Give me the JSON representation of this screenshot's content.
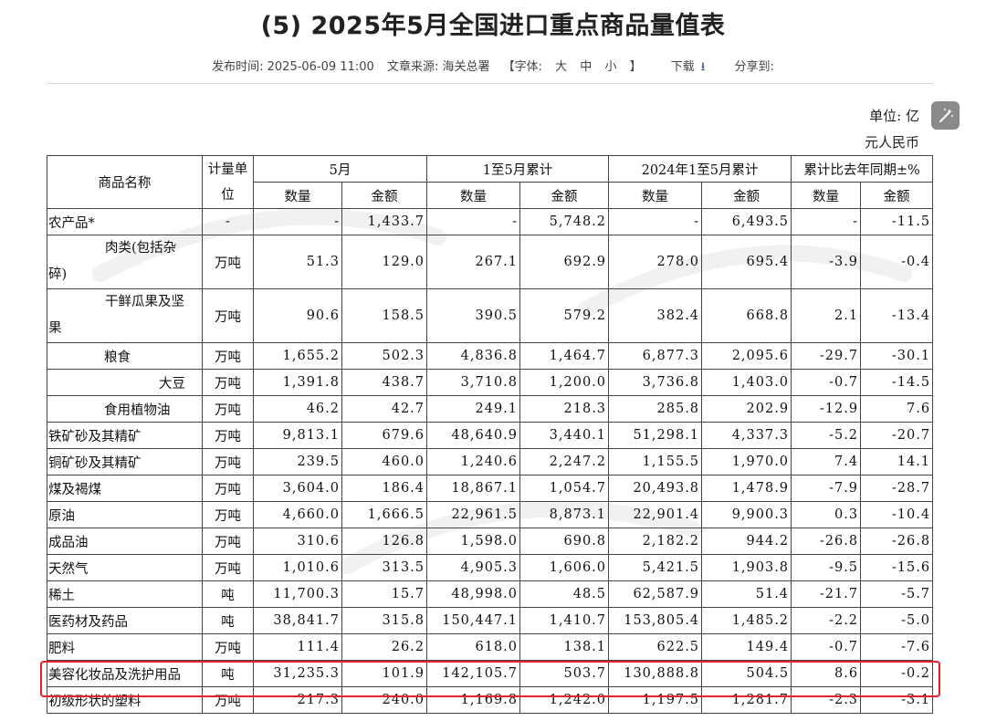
{
  "page": {
    "title": "(5) 2025年5月全国进口重点商品量值表",
    "meta": {
      "publish_label": "发布时间: 2025-06-09 11:00",
      "source_label": "文章来源: 海关总署",
      "font_label_open": "【字体:",
      "font_large": "大",
      "font_medium": "中",
      "font_small": "小",
      "font_label_close": "】",
      "download": "下载",
      "share": "分享到:"
    },
    "unit_line1": "单位: 亿",
    "unit_line2": "元人民币"
  },
  "table": {
    "headers": {
      "name": "商品名称",
      "unit": "计量单位",
      "may": "5月",
      "ytd": "1至5月累计",
      "prev_ytd": "2024年1至5月累计",
      "yoy": "累计比去年同期±%",
      "qty": "数量",
      "amt": "金额"
    },
    "rows": [
      {
        "name": "农产品*",
        "indent": 0,
        "unit": "-",
        "may_qty": "-",
        "may_amt": "1,433.7",
        "ytd_qty": "-",
        "ytd_amt": "5,748.2",
        "prev_qty": "-",
        "prev_amt": "6,493.5",
        "yoy_qty": "-",
        "yoy_amt": "-11.5"
      },
      {
        "name_a": "肉类(包括杂",
        "name_b": "碎)",
        "wrap": true,
        "unit": "万吨",
        "may_qty": "51.3",
        "may_amt": "129.0",
        "ytd_qty": "267.1",
        "ytd_amt": "692.9",
        "prev_qty": "278.0",
        "prev_amt": "695.4",
        "yoy_qty": "-3.9",
        "yoy_amt": "-0.4"
      },
      {
        "name_a": "干鲜瓜果及坚",
        "name_b": "果",
        "wrap": true,
        "unit": "万吨",
        "may_qty": "90.6",
        "may_amt": "158.5",
        "ytd_qty": "390.5",
        "ytd_amt": "579.2",
        "prev_qty": "382.4",
        "prev_amt": "668.8",
        "yoy_qty": "2.1",
        "yoy_amt": "-13.4"
      },
      {
        "name": "粮食",
        "indent": 1,
        "unit": "万吨",
        "may_qty": "1,655.2",
        "may_amt": "502.3",
        "ytd_qty": "4,836.8",
        "ytd_amt": "1,464.7",
        "prev_qty": "6,877.3",
        "prev_amt": "2,095.6",
        "yoy_qty": "-29.7",
        "yoy_amt": "-30.1"
      },
      {
        "name": "大豆",
        "indent": 2,
        "unit": "万吨",
        "may_qty": "1,391.8",
        "may_amt": "438.7",
        "ytd_qty": "3,710.8",
        "ytd_amt": "1,200.0",
        "prev_qty": "3,736.8",
        "prev_amt": "1,403.0",
        "yoy_qty": "-0.7",
        "yoy_amt": "-14.5"
      },
      {
        "name": "食用植物油",
        "indent": 1,
        "unit": "万吨",
        "may_qty": "46.2",
        "may_amt": "42.7",
        "ytd_qty": "249.1",
        "ytd_amt": "218.3",
        "prev_qty": "285.8",
        "prev_amt": "202.9",
        "yoy_qty": "-12.9",
        "yoy_amt": "7.6"
      },
      {
        "name": "铁矿砂及其精矿",
        "indent": 0,
        "unit": "万吨",
        "may_qty": "9,813.1",
        "may_amt": "679.6",
        "ytd_qty": "48,640.9",
        "ytd_amt": "3,440.1",
        "prev_qty": "51,298.1",
        "prev_amt": "4,337.3",
        "yoy_qty": "-5.2",
        "yoy_amt": "-20.7"
      },
      {
        "name": "铜矿砂及其精矿",
        "indent": 0,
        "unit": "万吨",
        "may_qty": "239.5",
        "may_amt": "460.0",
        "ytd_qty": "1,240.6",
        "ytd_amt": "2,247.2",
        "prev_qty": "1,155.5",
        "prev_amt": "1,970.0",
        "yoy_qty": "7.4",
        "yoy_amt": "14.1"
      },
      {
        "name": "煤及褐煤",
        "indent": 0,
        "unit": "万吨",
        "may_qty": "3,604.0",
        "may_amt": "186.4",
        "ytd_qty": "18,867.1",
        "ytd_amt": "1,054.7",
        "prev_qty": "20,493.8",
        "prev_amt": "1,478.9",
        "yoy_qty": "-7.9",
        "yoy_amt": "-28.7"
      },
      {
        "name": "原油",
        "indent": 0,
        "unit": "万吨",
        "may_qty": "4,660.0",
        "may_amt": "1,666.5",
        "ytd_qty": "22,961.5",
        "ytd_amt": "8,873.1",
        "prev_qty": "22,901.4",
        "prev_amt": "9,900.3",
        "yoy_qty": "0.3",
        "yoy_amt": "-10.4"
      },
      {
        "name": "成品油",
        "indent": 0,
        "unit": "万吨",
        "may_qty": "310.6",
        "may_amt": "126.8",
        "ytd_qty": "1,598.0",
        "ytd_amt": "690.8",
        "prev_qty": "2,182.2",
        "prev_amt": "944.2",
        "yoy_qty": "-26.8",
        "yoy_amt": "-26.8"
      },
      {
        "name": "天然气",
        "indent": 0,
        "unit": "万吨",
        "may_qty": "1,010.6",
        "may_amt": "313.5",
        "ytd_qty": "4,905.3",
        "ytd_amt": "1,606.0",
        "prev_qty": "5,421.5",
        "prev_amt": "1,903.8",
        "yoy_qty": "-9.5",
        "yoy_amt": "-15.6"
      },
      {
        "name": "稀土",
        "indent": 0,
        "unit": "吨",
        "may_qty": "11,700.3",
        "may_amt": "15.7",
        "ytd_qty": "48,998.0",
        "ytd_amt": "48.5",
        "prev_qty": "62,587.9",
        "prev_amt": "51.4",
        "yoy_qty": "-21.7",
        "yoy_amt": "-5.7"
      },
      {
        "name": "医药材及药品",
        "indent": 0,
        "unit": "吨",
        "may_qty": "38,841.7",
        "may_amt": "315.8",
        "ytd_qty": "150,447.1",
        "ytd_amt": "1,410.7",
        "prev_qty": "153,805.4",
        "prev_amt": "1,485.2",
        "yoy_qty": "-2.2",
        "yoy_amt": "-5.0"
      },
      {
        "name": "肥料",
        "indent": 0,
        "unit": "万吨",
        "may_qty": "111.4",
        "may_amt": "26.2",
        "ytd_qty": "618.0",
        "ytd_amt": "138.1",
        "prev_qty": "622.5",
        "prev_amt": "149.4",
        "yoy_qty": "-0.7",
        "yoy_amt": "-7.6"
      },
      {
        "name": "美容化妆品及洗护用品",
        "indent": 0,
        "unit": "吨",
        "may_qty": "31,235.3",
        "may_amt": "101.9",
        "ytd_qty": "142,105.7",
        "ytd_amt": "503.7",
        "prev_qty": "130,888.8",
        "prev_amt": "504.5",
        "yoy_qty": "8.6",
        "yoy_amt": "-0.2"
      },
      {
        "name": "初级形状的塑料",
        "indent": 0,
        "unit": "万吨",
        "may_qty": "217.3",
        "may_amt": "240.0",
        "ytd_qty": "1,169.8",
        "ytd_amt": "1,242.0",
        "prev_qty": "1,197.5",
        "prev_amt": "1,281.7",
        "yoy_qty": "-2.3",
        "yoy_amt": "-3.1"
      }
    ]
  }
}
